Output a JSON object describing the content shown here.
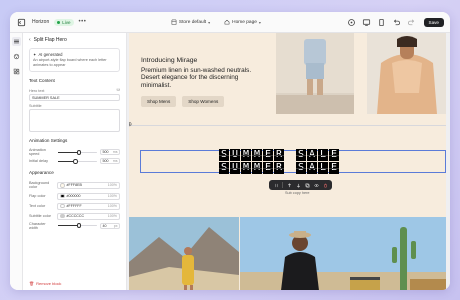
{
  "topbar": {
    "site_name": "Horizon",
    "live_label": "Live",
    "more_label": "•••",
    "store_select": "Store default",
    "page_select": "Home page",
    "save_label": "Save"
  },
  "rail": {
    "items": [
      "layers-icon",
      "theme-icon",
      "apps-icon"
    ]
  },
  "panel": {
    "back_label": "‹",
    "title": "Split Flap Hero",
    "ai_title": "AI generated",
    "ai_desc": "An airport-style flap board where each letter animates to appear",
    "text_section": "Text Content",
    "hero_text_label": "Hero text",
    "hero_text_value": "SUMMER SALE",
    "subtitle_label": "Subtitle",
    "subtitle_value": "",
    "animation_section": "Animation Settings",
    "speed_label": "Animation speed",
    "speed_value": "500",
    "speed_unit": "ms",
    "speed_level": 0.55,
    "delay_label": "Initial delay",
    "delay_value": "500",
    "delay_unit": "ms",
    "delay_level": 0.45,
    "appearance_section": "Appearance",
    "colors": [
      {
        "label": "Background color",
        "hex": "#FFF8EB",
        "swatch": "#fff8eb",
        "pct": "100%"
      },
      {
        "label": "Flap color",
        "hex": "#000000",
        "swatch": "#000000",
        "pct": "100%"
      },
      {
        "label": "Text color",
        "hex": "#FFFFFF",
        "swatch": "#ffffff",
        "pct": "100%"
      },
      {
        "label": "Subtitle color",
        "hex": "#CCCCCC",
        "swatch": "#cccccc",
        "pct": "100%"
      }
    ],
    "char_width_label": "Character width",
    "char_width_value": "40",
    "char_width_unit": "px",
    "char_width_level": 0.55,
    "remove_label": "Remove block"
  },
  "canvas": {
    "hero_title": "Introducing Mirage",
    "hero_subtitle": "Premium linen in sun-washed neutrals. Desert elegance for the discerning minimalist.",
    "btn_men": "Shop Mens",
    "btn_women": "Shop Womens",
    "flap_line_1": "SUMMER SALE",
    "flap_line_2": "SUMMER SALE",
    "caption": "Sub copy here"
  },
  "colors": {
    "accent": "#5b7bd8",
    "live": "#23a34a",
    "danger": "#d23b3b",
    "page_bg": "#f7ecdd"
  }
}
